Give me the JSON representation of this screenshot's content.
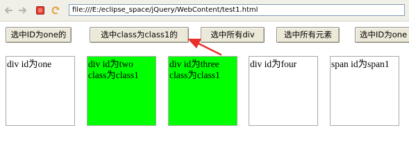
{
  "browser": {
    "address": "file:///E:/eclipse_space/jQuery/WebContent/test1.html"
  },
  "buttons": {
    "select_id_one": "选中ID为one的",
    "select_class1": "选中class为class1的",
    "select_all_div": "选中所有div",
    "select_all": "选中所有元素",
    "select_id_one_2": "选中ID为one"
  },
  "boxes": {
    "one": {
      "line1": "div id为one",
      "line2": ""
    },
    "two": {
      "line1": "div id为two",
      "line2": "class为class1"
    },
    "three": {
      "line1": "div id为three",
      "line2": "class为class1"
    },
    "four": {
      "line1": "div id为four",
      "line2": ""
    },
    "span1": {
      "line1": "span id为span1",
      "line2": ""
    }
  },
  "colors": {
    "highlight": "#00ff00",
    "arrow": "#e8302a"
  },
  "icons": [
    "back-arrow-icon",
    "forward-arrow-icon",
    "stop-icon",
    "refresh-icon"
  ]
}
